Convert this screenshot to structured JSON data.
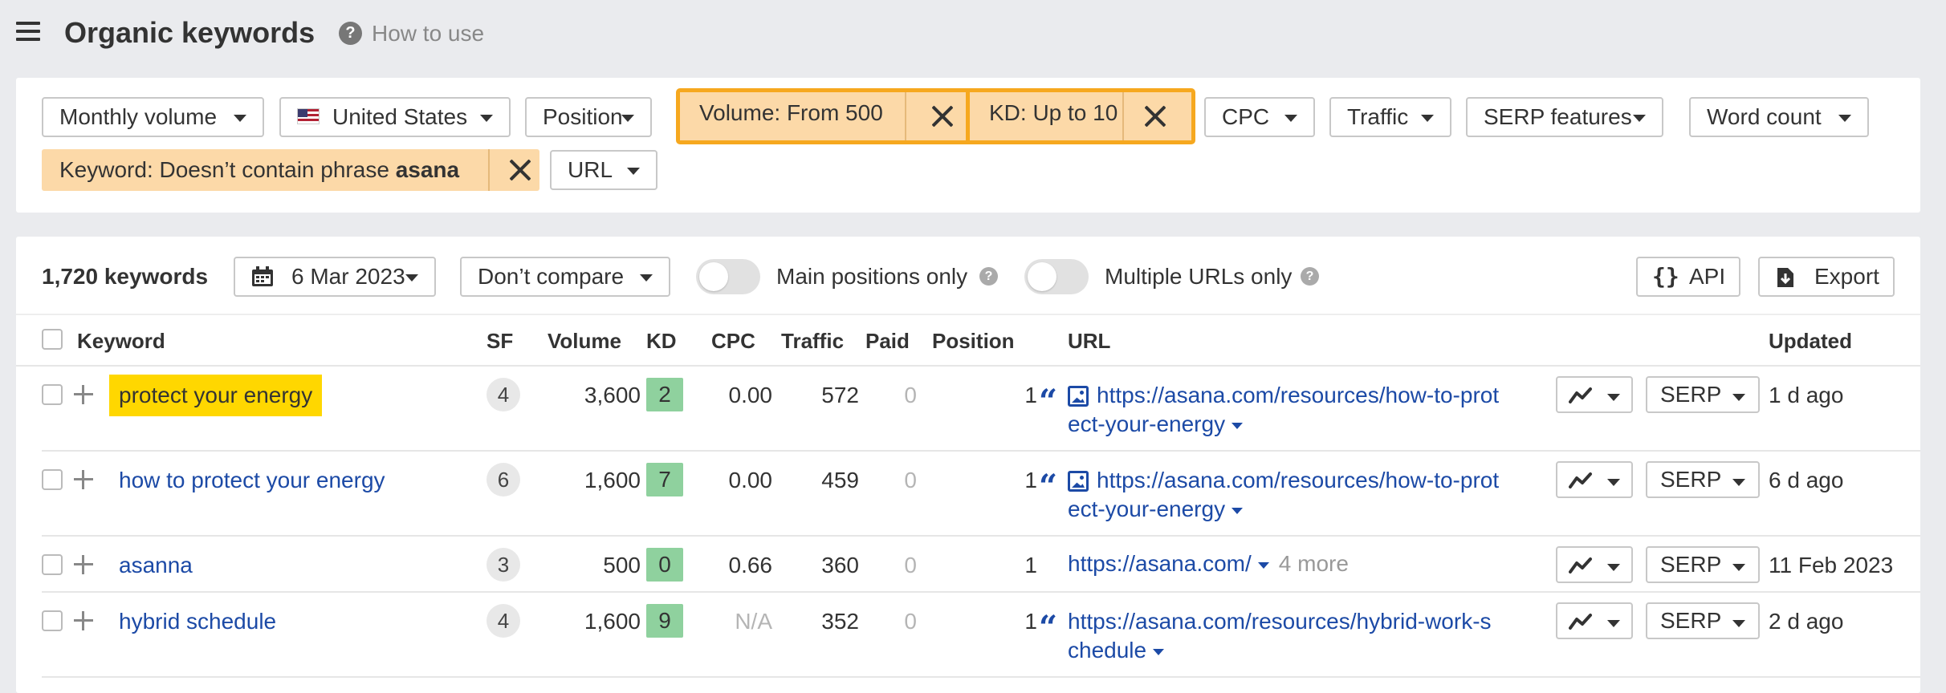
{
  "header": {
    "title": "Organic keywords",
    "help_label": "How to use"
  },
  "filters": {
    "monthly_volume": "Monthly volume",
    "country": "United States",
    "position": "Position",
    "volume_filter": "Volume: From 500",
    "kd_filter": "KD: Up to 10",
    "cpc": "CPC",
    "traffic": "Traffic",
    "serp_features": "SERP features",
    "word_count": "Word count",
    "keyword_filter_prefix": "Keyword: Doesn’t contain phrase",
    "keyword_filter_term": "asana",
    "url": "URL"
  },
  "toolbar": {
    "keyword_count": "1,720 keywords",
    "date": "6 Mar 2023",
    "compare": "Don’t compare",
    "main_positions_label": "Main positions only",
    "main_positions_on": false,
    "multiple_urls_label": "Multiple URLs only",
    "multiple_urls_on": false,
    "api_label": "API",
    "export_label": "Export"
  },
  "table": {
    "columns": [
      "Keyword",
      "SF",
      "Volume",
      "KD",
      "CPC",
      "Traffic",
      "Paid",
      "Position",
      "URL",
      "Updated"
    ],
    "serp_label": "SERP",
    "rows": [
      {
        "keyword": "protect your energy",
        "sf": "4",
        "volume": "3,600",
        "kd": "2",
        "cpc": "0.00",
        "traffic": "572",
        "paid": "0",
        "position": "1",
        "url_line1": "https://asana.com/resources/how-to-prot",
        "url_line2": "ect-your-energy",
        "updated": "1 d ago"
      },
      {
        "keyword": "how to protect your energy",
        "sf": "6",
        "volume": "1,600",
        "kd": "7",
        "cpc": "0.00",
        "traffic": "459",
        "paid": "0",
        "position": "1",
        "url_line1": "https://asana.com/resources/how-to-prot",
        "url_line2": "ect-your-energy",
        "updated": "6 d ago"
      },
      {
        "keyword": "asanna",
        "sf": "3",
        "volume": "500",
        "kd": "0",
        "cpc": "0.66",
        "traffic": "360",
        "paid": "0",
        "position": "1",
        "url_line1": "https://asana.com/",
        "more": "4 more",
        "updated": "11 Feb 2023"
      },
      {
        "keyword": "hybrid schedule",
        "sf": "4",
        "volume": "1,600",
        "kd": "9",
        "cpc": "N/A",
        "traffic": "352",
        "paid": "0",
        "position": "1",
        "url_line1": "https://asana.com/resources/hybrid-work-s",
        "url_line2": "chedule",
        "updated": "2 d ago"
      }
    ]
  },
  "colors": {
    "highlight": "#ffd700",
    "filter_active_border": "#f6a81f",
    "filter_active_bg": "#fcd9a8",
    "kd_easy": "#8fd19e",
    "link": "#1c4aa6"
  }
}
